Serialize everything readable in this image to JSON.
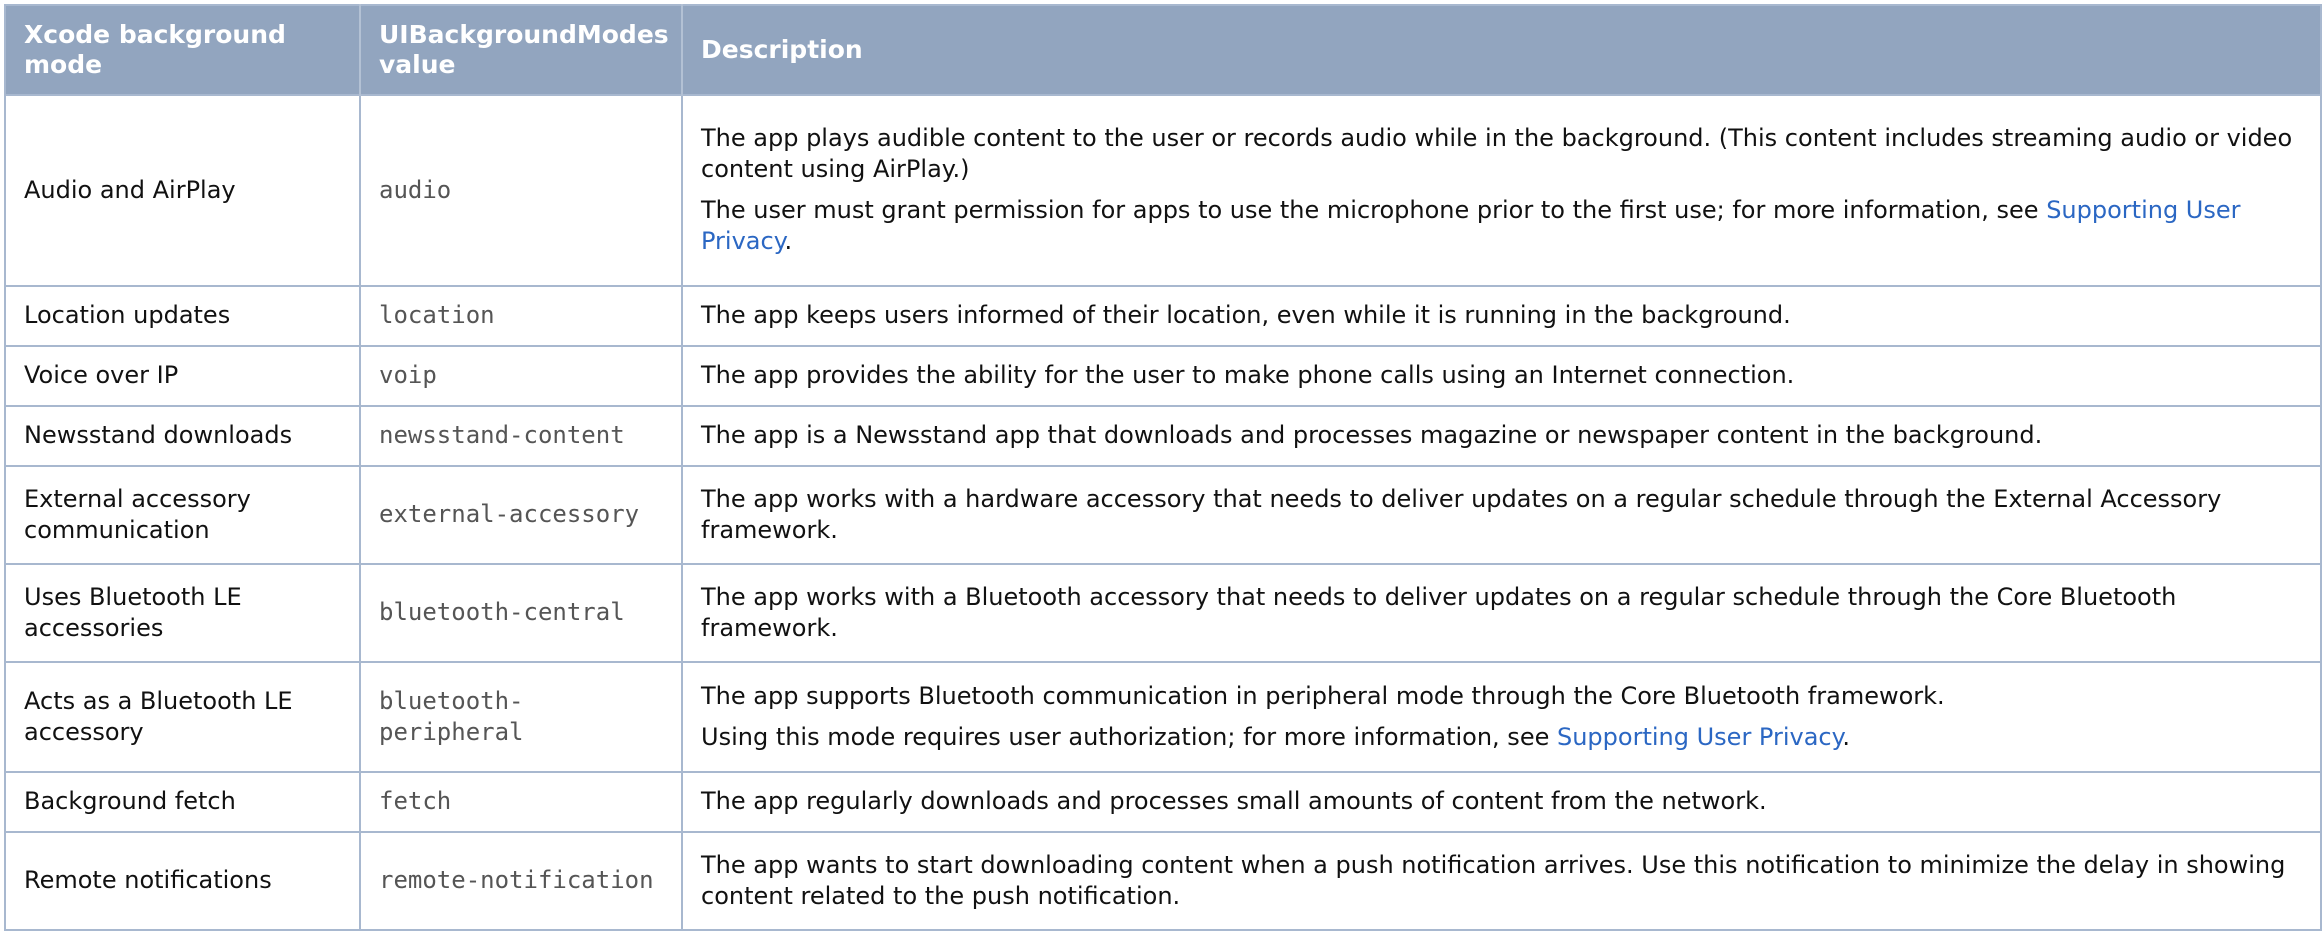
{
  "table": {
    "headers": {
      "mode": "Xcode background mode",
      "value": "UIBackgroundModes value",
      "description": "Description"
    },
    "rows": [
      {
        "mode": "Audio and AirPlay",
        "value": "audio",
        "desc": [
          {
            "text": "The app plays audible content to the user or records audio while in the background. (This content includes streaming audio or video content using AirPlay.)"
          },
          {
            "text": "The user must grant permission for apps to use the microphone prior to the first use; for more information, see ",
            "link": "Supporting User Privacy",
            "after": "."
          }
        ]
      },
      {
        "mode": "Location updates",
        "value": "location",
        "desc": [
          {
            "text": "The app keeps users informed of their location, even while it is running in the background."
          }
        ]
      },
      {
        "mode": "Voice over IP",
        "value": "voip",
        "desc": [
          {
            "text": "The app provides the ability for the user to make phone calls using an Internet connection."
          }
        ]
      },
      {
        "mode": "Newsstand downloads",
        "value": "newsstand-content",
        "desc": [
          {
            "text": "The app is a Newsstand app that downloads and processes magazine or newspaper content in the background."
          }
        ]
      },
      {
        "mode": "External accessory communication",
        "value": "external-accessory",
        "desc": [
          {
            "text": "The app works with a hardware accessory that needs to deliver updates on a regular schedule through the External Accessory framework."
          }
        ]
      },
      {
        "mode": "Uses Bluetooth LE accessories",
        "value": "bluetooth-central",
        "desc": [
          {
            "text": "The app works with a Bluetooth accessory that needs to deliver updates on a regular schedule through the Core Bluetooth framework."
          }
        ]
      },
      {
        "mode": "Acts as a Bluetooth LE accessory",
        "value": "bluetooth-peripheral",
        "desc": [
          {
            "text": "The app supports Bluetooth communication in peripheral mode through the Core Bluetooth framework."
          },
          {
            "text": "Using this mode requires user authorization; for more information, see ",
            "link": "Supporting User Privacy",
            "after": "."
          }
        ]
      },
      {
        "mode": "Background fetch",
        "value": "fetch",
        "desc": [
          {
            "text": "The app regularly downloads and processes small amounts of content from the network."
          }
        ]
      },
      {
        "mode": "Remote notifications",
        "value": "remote-notification",
        "desc": [
          {
            "text": "The app wants to start downloading content when a push notification arrives. Use this notification to minimize the delay in showing content related to the push notification."
          }
        ]
      }
    ]
  }
}
